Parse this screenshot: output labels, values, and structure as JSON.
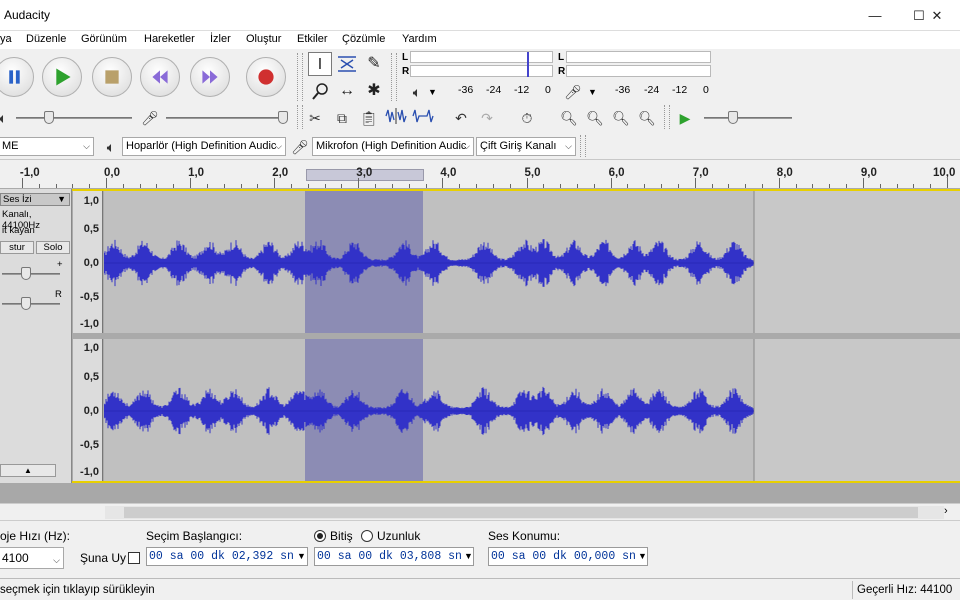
{
  "window": {
    "title": "Audacity",
    "minimize": "—",
    "maximize": "☐",
    "close": "✕"
  },
  "menu": [
    "ya",
    "Düzenle",
    "Görünüm",
    "Hareketler",
    "İzler",
    "Oluştur",
    "Etkiler",
    "Çözümle",
    "Yardım"
  ],
  "meters": {
    "rec_ticks": [
      "-36",
      "-24",
      "-12",
      "0"
    ],
    "play_ticks": [
      "-36",
      "-24",
      "-12",
      "0"
    ],
    "left_label": "L",
    "right_label": "R"
  },
  "devices": {
    "host": "ME",
    "output": "Hoparlör (High Definition Audic",
    "input": "Mikrofon (High Definition Audic",
    "channels": "Çift Giriş Kanalı"
  },
  "ruler": [
    "-1,0",
    "0,0",
    "1,0",
    "2,0",
    "3,0",
    "4,0",
    "5,0",
    "6,0",
    "7,0",
    "8,0",
    "9,0",
    "10,0"
  ],
  "track": {
    "name": "Ses İzi",
    "info": "Kanalı, 44100Hz",
    "format": "it kayan",
    "mute": "stur",
    "solo": "Solo",
    "gain_plus": "+",
    "pan_right": "R",
    "collapse": "▲",
    "scale": [
      "1,0",
      "0,5",
      "0,0",
      "-0,5",
      "-1,0"
    ]
  },
  "selection_toolbar": {
    "rate_label": "oje Hızı (Hz):",
    "rate_value": "4100",
    "snap_label": "Şuna Uy",
    "start_label": "Seçim Başlangıcı:",
    "end_label": "Bitiş",
    "length_label": "Uzunluk",
    "start_value": "00 sa 00 dk 02,392 sn",
    "end_value": "00 sa 00 dk 03,808 sn",
    "position_label": "Ses Konumu:",
    "position_value": "00 sa 00 dk 00,000 sn"
  },
  "status": {
    "hint": "seçmek için tıklayıp sürükleyin",
    "rate": "Geçerli Hız: 44100"
  },
  "colors": {
    "wave": "#3232c8",
    "selection": "#8c8cb4",
    "background": "#c0c0c0"
  }
}
